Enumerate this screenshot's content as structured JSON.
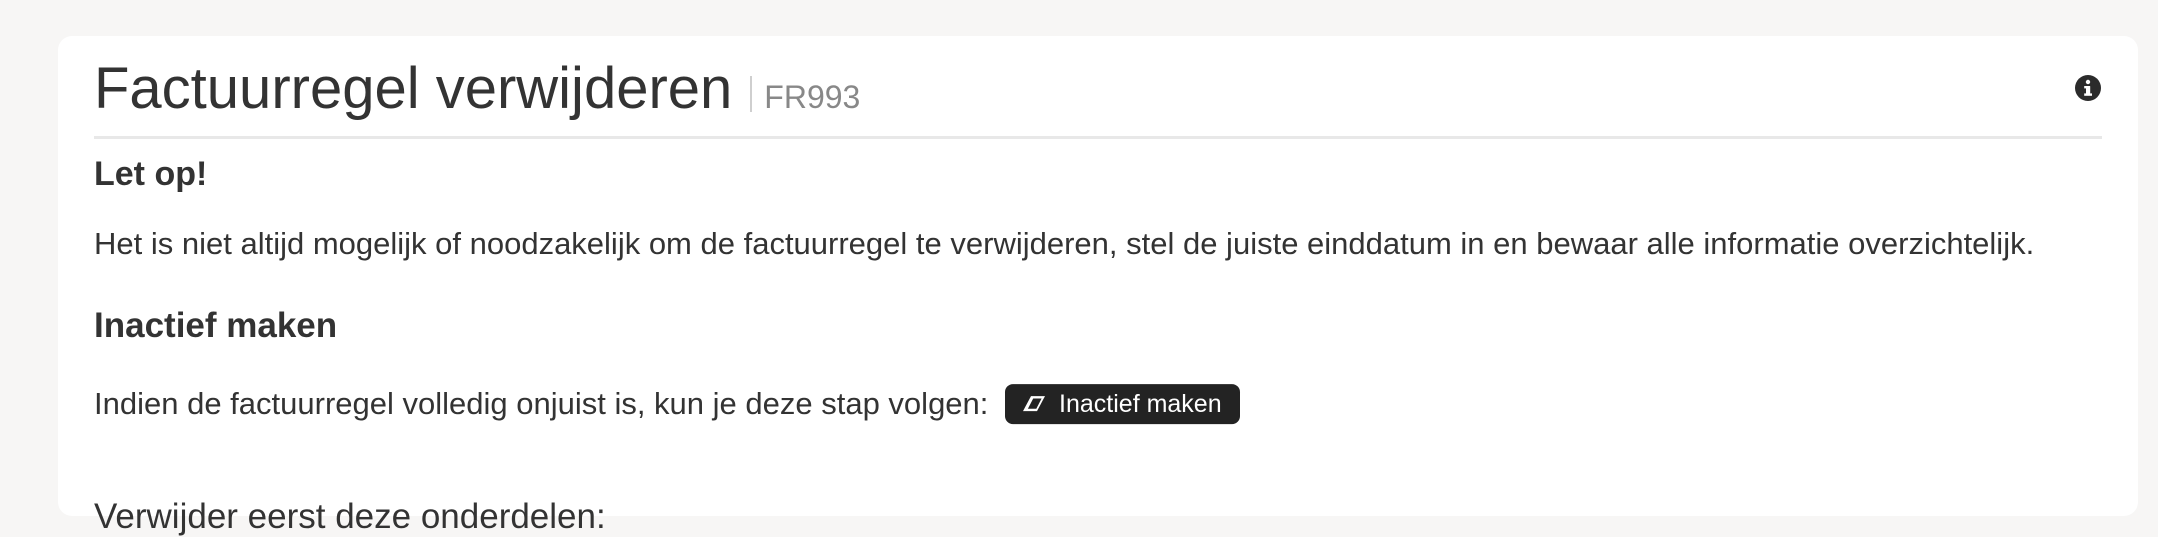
{
  "header": {
    "title": "Factuurregel verwijderen",
    "code": "FR993",
    "info_icon": "info-circle-icon"
  },
  "warning": {
    "heading": "Let op!",
    "text": "Het is niet altijd mogelijk of noodzakelijk om de factuurregel te verwijderen, stel de juiste einddatum in en bewaar alle informatie overzichtelijk."
  },
  "deactivate": {
    "heading": "Inactief maken",
    "text": "Indien de factuurregel volledig onjuist is, kun je deze stap volgen:",
    "button_label": "Inactief maken",
    "button_icon": "eraser-icon"
  },
  "remove_first": {
    "heading": "Verwijder eerst deze onderdelen:"
  },
  "colors": {
    "page_background": "#f7f6f5",
    "card_background": "#ffffff",
    "text": "#333333",
    "muted_text": "#888888",
    "button_background": "#232323",
    "button_text": "#ffffff",
    "divider": "#e8e8e8"
  }
}
